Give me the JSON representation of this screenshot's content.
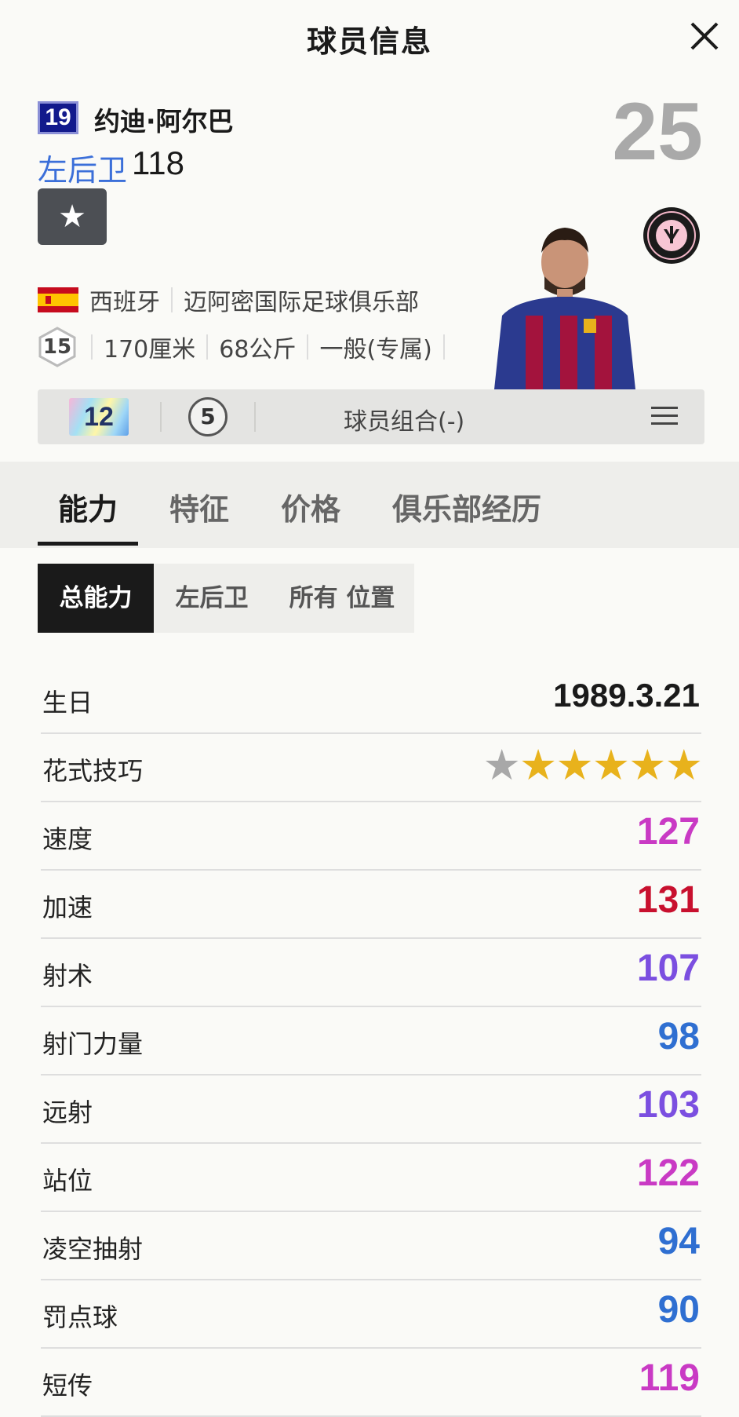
{
  "header": {
    "title": "球员信息"
  },
  "player": {
    "season_number": "19",
    "name": "约迪·阿尔巴",
    "position": "左后卫",
    "position_rating": "118",
    "overall": "25",
    "favorite_symbol": "★",
    "nationality": "西班牙",
    "club": "迈阿密国际足球俱乐部",
    "skill_level": "15",
    "height": "170厘米",
    "weight": "68公斤",
    "body_type": "一般(专属)"
  },
  "combo_bar": {
    "grade": "12",
    "level": "5",
    "label": "球员组合(-)"
  },
  "tabs": [
    "能力",
    "特征",
    "价格",
    "俱乐部经历"
  ],
  "subtabs": [
    "总能力",
    "左后卫",
    "所有 位置"
  ],
  "stats": [
    {
      "label": "生日",
      "value": "1989.3.21",
      "color": "#1a1a1a"
    },
    {
      "label": "花式技巧",
      "value": "",
      "stars_total": 6,
      "stars_filled": 5
    },
    {
      "label": "速度",
      "value": "127",
      "color": "#c93ac4"
    },
    {
      "label": "加速",
      "value": "131",
      "color": "#c8102e"
    },
    {
      "label": "射术",
      "value": "107",
      "color": "#7b4fe0"
    },
    {
      "label": "射门力量",
      "value": "98",
      "color": "#2f6fd1"
    },
    {
      "label": "远射",
      "value": "103",
      "color": "#7b4fe0"
    },
    {
      "label": "站位",
      "value": "122",
      "color": "#c93ac4"
    },
    {
      "label": "凌空抽射",
      "value": "94",
      "color": "#2f6fd1"
    },
    {
      "label": "罚点球",
      "value": "90",
      "color": "#2f6fd1"
    },
    {
      "label": "短传",
      "value": "119",
      "color": "#c93ac4"
    }
  ],
  "colors": {
    "accent_blue": "#3b6fd9",
    "star_gold": "#e8b21c",
    "star_grey": "#a8a8a8"
  }
}
